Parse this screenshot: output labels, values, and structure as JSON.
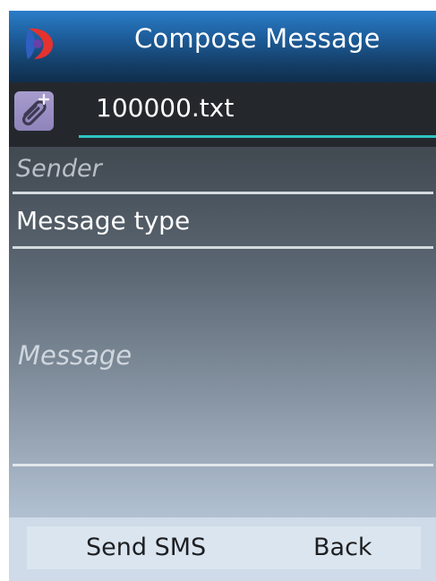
{
  "header": {
    "title": "Compose Message",
    "logo_icon": "app-logo-icon"
  },
  "attachment": {
    "icon": "paperclip-add-icon",
    "filename": "100000.txt"
  },
  "form": {
    "sender_placeholder": "Sender",
    "message_type_label": "Message type",
    "message_placeholder": "Message"
  },
  "softkeys": {
    "left": "Send SMS",
    "right": "Back"
  },
  "colors": {
    "header_blue": "#1e5f9e",
    "input_accent": "#2ec4c4",
    "attach_button": "#9a8fc4",
    "softkey_bar": "#cfdbe8"
  }
}
